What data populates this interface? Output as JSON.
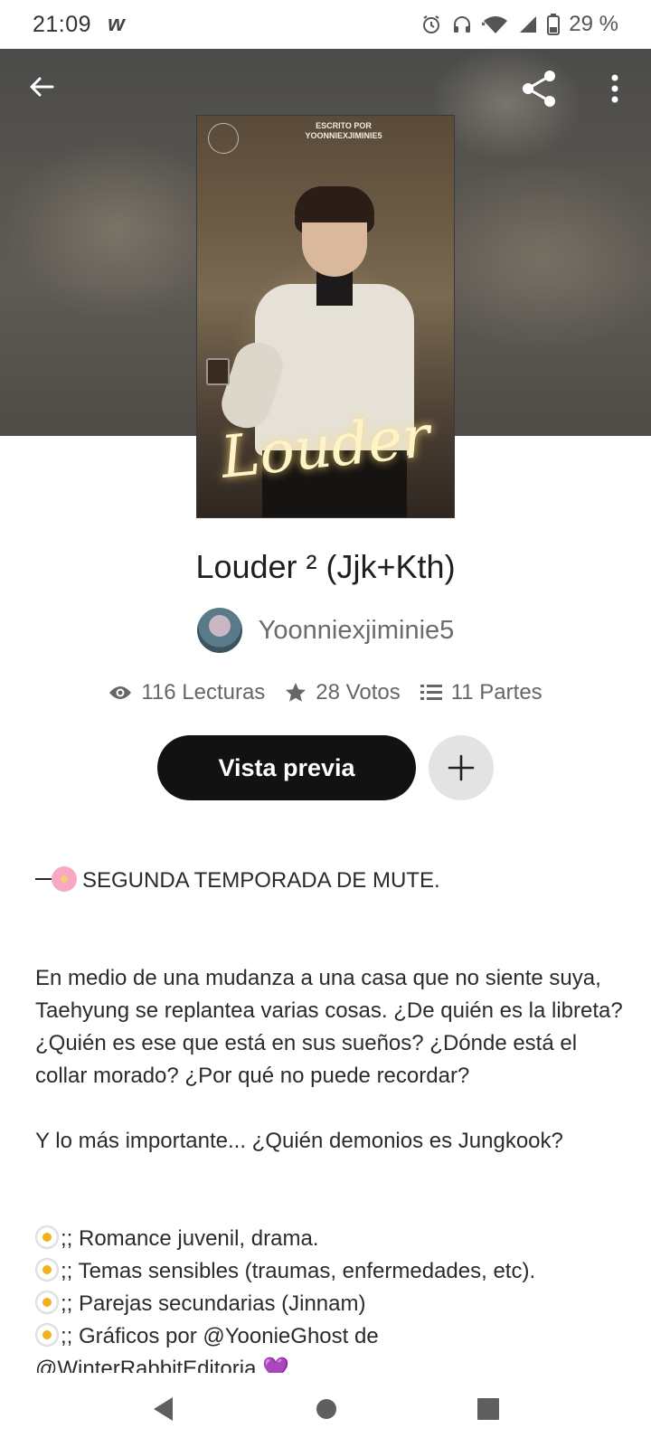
{
  "status_bar": {
    "time": "21:09",
    "app_badge": "w",
    "battery": "29 %",
    "icons": [
      "alarm-icon",
      "headphones-icon",
      "wifi-icon",
      "signal-icon",
      "battery-icon"
    ]
  },
  "header": {
    "back_icon": "arrow-left-icon",
    "share_icon": "share-icon",
    "more_icon": "more-vertical-icon"
  },
  "cover": {
    "credit_line1": "ESCRITO POR",
    "credit_line2": "YOONNIEXJIMINIE5",
    "title_art": "Louder"
  },
  "story": {
    "title": "Louder ² (Jjk+Kth)",
    "author": "Yoonniexjiminie5",
    "stats": {
      "reads": "116 Lecturas",
      "votes": "28 Votos",
      "parts": "11 Partes"
    }
  },
  "actions": {
    "preview_label": "Vista previa",
    "add_icon": "plus-icon"
  },
  "description": {
    "season_line": "SEGUNDA TEMPORADA DE MUTE.",
    "paragraph": "En medio de una mudanza a una casa que no siente suya, Taehyung se replantea varias cosas. ¿De quién es la libreta? ¿Quién es ese que está en sus sueños? ¿Dónde está el collar morado? ¿Por qué no puede recordar?",
    "question": "Y lo más importante... ¿Quién demonios es Jungkook?",
    "tags": [
      ";; Romance juvenil, drama.",
      ";; Temas sensibles (traumas, enfermedades, etc).",
      ";; Parejas secundarias (Jinnam)",
      ";; Gráficos por @YoonieGhost de",
      "@WinterRabbitEditoria 💜"
    ]
  },
  "nav": {
    "back_icon": "nav-back-triangle-icon",
    "home_icon": "nav-home-circle-icon",
    "recents_icon": "nav-recents-square-icon"
  },
  "colors": {
    "primary_button": "#121212",
    "secondary_button": "#e3e3e3",
    "muted_text": "#666666"
  }
}
